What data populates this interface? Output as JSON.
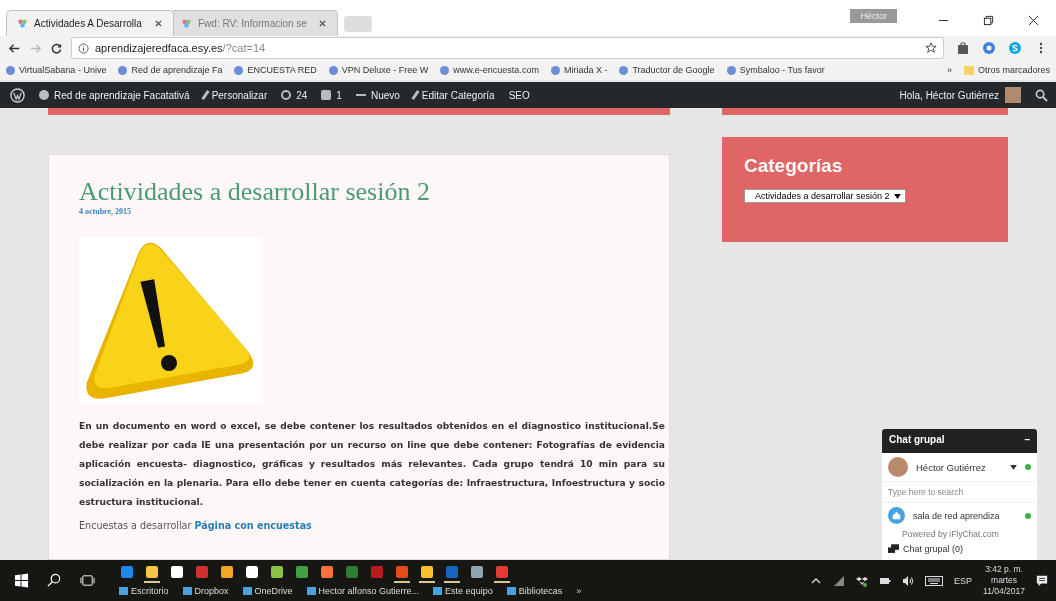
{
  "browser": {
    "tabs": [
      {
        "title": "Actividades A Desarrolla",
        "selected": true
      },
      {
        "title": "Fwd: RV: Informacion se",
        "selected": false
      }
    ],
    "profile": "Héctor",
    "address": {
      "host": "aprendizajeredfaca.esy.es",
      "path": "/?cat=14"
    },
    "bookmarks": [
      "VirtualSabana - Unive",
      "Red de aprendizaje Fa",
      "ENCUESTA RED",
      "VPN Deluxe - Free W",
      "www.e-encuesta.com",
      "Miriada X -",
      "Traductor de Google",
      "Symbaloo - Tus favor"
    ],
    "bookmarks_more": "»",
    "other_bookmarks": "Otros marcadores"
  },
  "admin_bar": {
    "site": "Red de aprendizaje Facatativá",
    "customize": "Personalizar",
    "updates": "24",
    "comments": "1",
    "new": "Nuevo",
    "edit": "Editar Categoría",
    "seo": "SEO",
    "greeting": "Hola, Héctor Gutiérrez"
  },
  "article": {
    "title": "Actividades a desarrollar sesión 2",
    "date": "4 octubre, 2015",
    "body": "En un documento en word o excel, se debe contener los resultados obtenidos en el diagnostico institucional.Se debe realizar por cada IE una presentación por un recurso on line que debe contener: Fotografías de evidencia aplicación encuesta- diagnostico, gráficas y resultados más relevantes. Cada grupo tendrá 10 min para su socialización en la plenaria. Para ello debe tener en cuenta categorías de: Infraestructura, Infoestructura y socio estructura institucional.",
    "link_prefix": "Encuestas a desarrollar",
    "link": "Página con encuestas"
  },
  "sidebar": {
    "title": "Categorías",
    "select": "Actividades a desarrollar sesión 2"
  },
  "chat": {
    "title": "Chat grupal",
    "minimize": "–",
    "user": "Héctor Gutiérrez",
    "search_placeholder": "Type here to search",
    "room": "sala de red aprendiza",
    "powered": "Powered by iFlyChat.com",
    "footer": "Chat grupal (0)"
  },
  "taskbar": {
    "toolbar": [
      "Escritorio",
      "Dropbox",
      "OneDrive",
      "Hector alfonso Gutierre...",
      "Este equipo",
      "Bibliotecas"
    ],
    "apps": [
      {
        "color": "#1e88e5",
        "running": false
      },
      {
        "color": "#f4c542",
        "running": true
      },
      {
        "color": "#ffffff",
        "running": false
      },
      {
        "color": "#d32f2f",
        "running": false
      },
      {
        "color": "#f5a623",
        "running": false
      },
      {
        "color": "#ffffff",
        "running": false
      },
      {
        "color": "#8bc34a",
        "running": false
      },
      {
        "color": "#43a047",
        "running": false
      },
      {
        "color": "#ff7043",
        "running": false
      },
      {
        "color": "#2e7d32",
        "running": false
      },
      {
        "color": "#b71c1c",
        "running": false
      },
      {
        "color": "#e64a19",
        "running": true
      },
      {
        "color": "#fbc02d",
        "running": true
      },
      {
        "color": "#1565c0",
        "running": true
      },
      {
        "color": "#90a4ae",
        "running": false
      },
      {
        "color": "#e53935",
        "running": true
      }
    ],
    "overflow": "»",
    "language": "ESP",
    "time": "3:42 p. m.",
    "day": "martes",
    "date": "11/04/2017"
  }
}
